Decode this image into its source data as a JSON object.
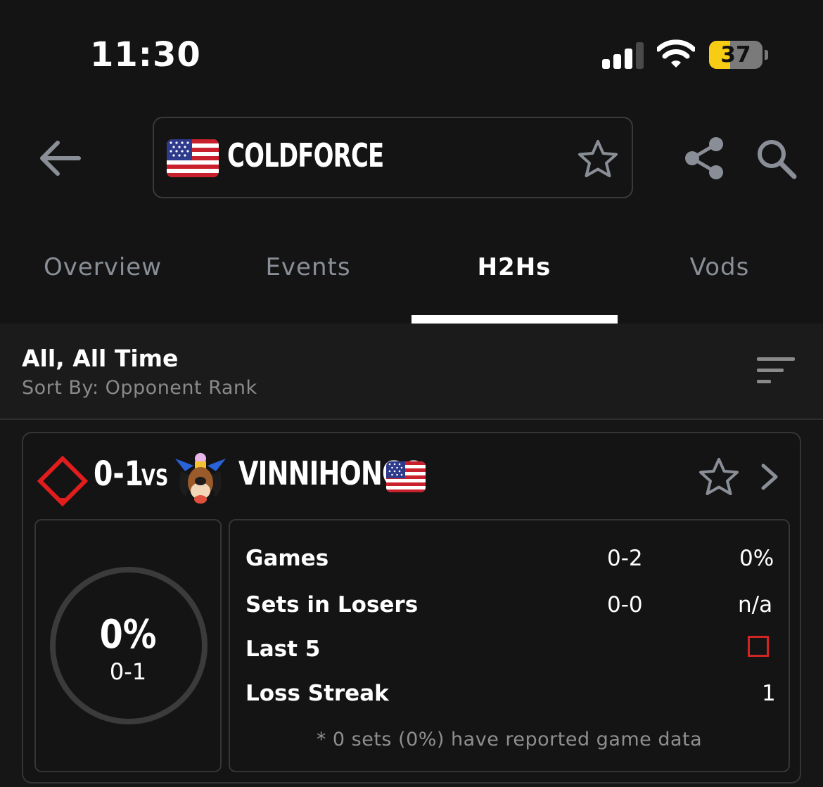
{
  "status_bar": {
    "time": "11:30",
    "battery": "37",
    "battery_level": 0.37
  },
  "header": {
    "player_name": "COLDFORCE",
    "player_flag": "us-flag-icon",
    "actions": [
      "back-arrow-icon",
      "star-icon",
      "share-icon",
      "search-icon"
    ]
  },
  "tabs": [
    {
      "label": "Overview",
      "active": false
    },
    {
      "label": "Events",
      "active": false
    },
    {
      "label": "H2Hs",
      "active": true
    },
    {
      "label": "Vods",
      "active": false
    }
  ],
  "filter": {
    "title": "All, All Time",
    "subtitle": "Sort By: Opponent Rank"
  },
  "h2h_card": {
    "record": "0-1",
    "vs": "VS",
    "opponent_name": "VINNIHONGO",
    "opponent_flag": "us-flag-icon",
    "win_pct": "0%",
    "set_record": "0-1",
    "stats": {
      "games_label": "Games",
      "games_value": "0-2",
      "games_pct": "0%",
      "losers_label": "Sets in Losers",
      "losers_value": "0-0",
      "losers_pct": "n/a",
      "last5_label": "Last 5",
      "streak_label": "Loss Streak",
      "streak_value": "1"
    },
    "footnote": "* 0 sets (0%) have reported game data"
  },
  "colors": {
    "background": "#161616",
    "loss_red": "#d12424",
    "battery_yellow": "#f6cc14",
    "muted_text": "#8a8f97"
  }
}
